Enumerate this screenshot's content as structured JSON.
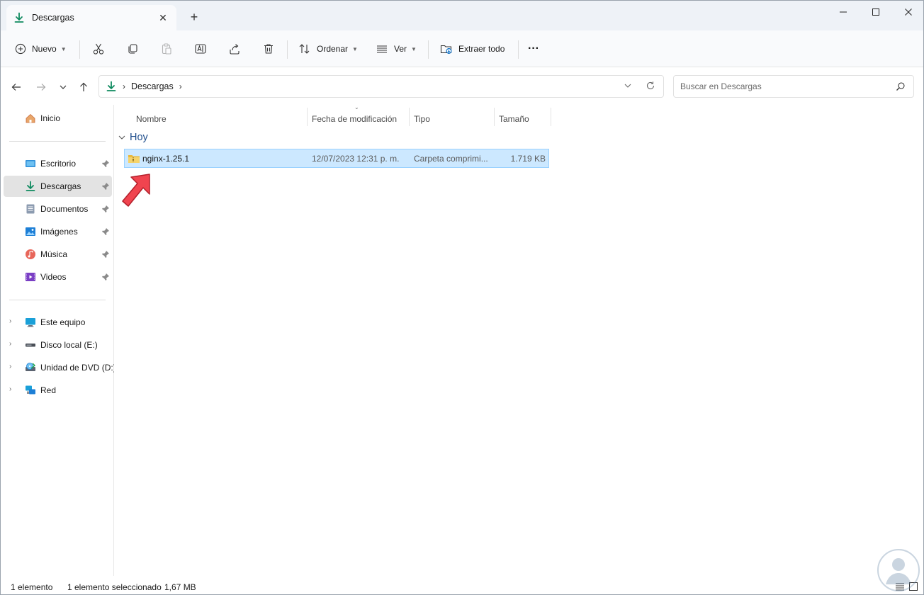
{
  "window": {
    "tab_title": "Descargas",
    "tab_close": "✕",
    "new_tab": "+"
  },
  "toolbar": {
    "new_label": "Nuevo",
    "sort_label": "Ordenar",
    "view_label": "Ver",
    "extract_all_label": "Extraer todo",
    "more_label": "···"
  },
  "address": {
    "crumbs": [
      "Descargas"
    ],
    "separator": "›"
  },
  "search": {
    "placeholder": "Buscar en Descargas"
  },
  "sidebar": {
    "home": "Inicio",
    "quick_access": [
      {
        "label": "Escritorio"
      },
      {
        "label": "Descargas"
      },
      {
        "label": "Documentos"
      },
      {
        "label": "Imágenes"
      },
      {
        "label": "Música"
      },
      {
        "label": "Videos"
      }
    ],
    "devices": [
      {
        "label": "Este equipo"
      },
      {
        "label": "Disco local (E:)"
      },
      {
        "label": "Unidad de DVD (D:)"
      },
      {
        "label": "Red"
      }
    ],
    "expand_glyph": "›"
  },
  "columns": {
    "name": "Nombre",
    "modified": "Fecha de modificación",
    "type": "Tipo",
    "size": "Tamaño",
    "sort_caret": "⌄"
  },
  "content": {
    "group": "Hoy",
    "files": [
      {
        "name": "nginx-1.25.1",
        "modified": "12/07/2023 12:31 p. m.",
        "type": "Carpeta comprimi...",
        "size": "1.719 KB"
      }
    ]
  },
  "status": {
    "count": "1 elemento",
    "selection": "1 elemento seleccionado",
    "selection_size": "1,67 MB"
  },
  "colors": {
    "accent": "#0f8a5f",
    "selection": "#cce8ff",
    "arrow": "#f0444f"
  }
}
